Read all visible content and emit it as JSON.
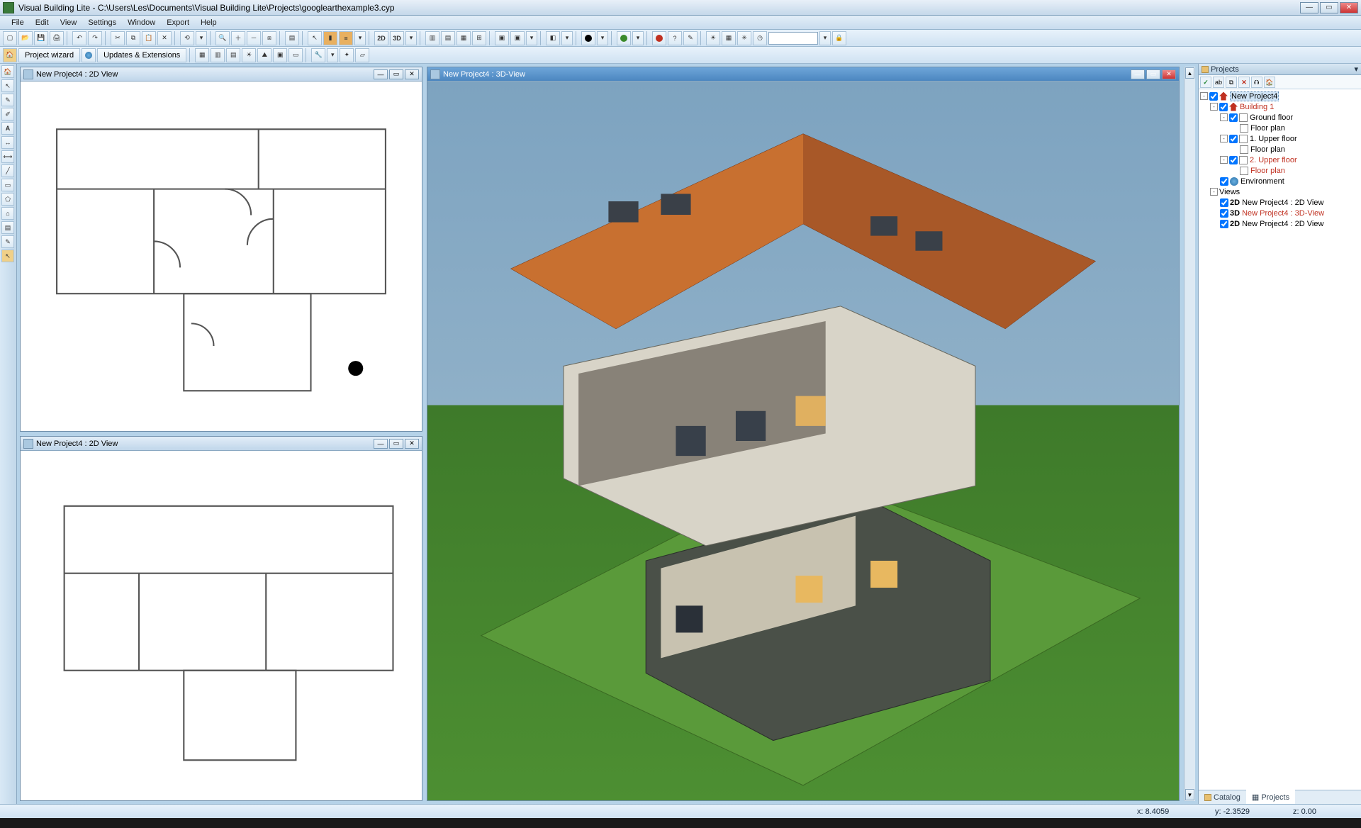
{
  "titlebar": {
    "text": "Visual Building Lite - C:\\Users\\Les\\Documents\\Visual Building Lite\\Projects\\googlearthexample3.cyp"
  },
  "menu": [
    "File",
    "Edit",
    "View",
    "Settings",
    "Window",
    "Export",
    "Help"
  ],
  "toolbar2": {
    "project_wizard": "Project wizard",
    "updates": "Updates & Extensions"
  },
  "windows": {
    "view2d_a": "New Project4 : 2D View",
    "view2d_b": "New Project4 : 2D View",
    "view3d": "New Project4 : 3D-View"
  },
  "projects_panel": {
    "title": "Projects",
    "tree": {
      "root": "New Project4",
      "building": "Building 1",
      "ground_floor": "Ground floor",
      "floor_plan": "Floor plan",
      "upper1": "1. Upper floor",
      "upper2": "2. Upper floor",
      "environment": "Environment",
      "views": "Views",
      "v1_tag": "2D",
      "v1": "New Project4 : 2D View",
      "v2_tag": "3D",
      "v2": "New Project4 : 3D-View",
      "v3_tag": "2D",
      "v3": "New Project4 : 2D View"
    },
    "tabs": {
      "catalog": "Catalog",
      "projects": "Projects"
    }
  },
  "status": {
    "x_label": "x:",
    "x": "8.4059",
    "y_label": "y:",
    "y": "-2.3529",
    "z_label": "z:",
    "z": "0.00"
  }
}
